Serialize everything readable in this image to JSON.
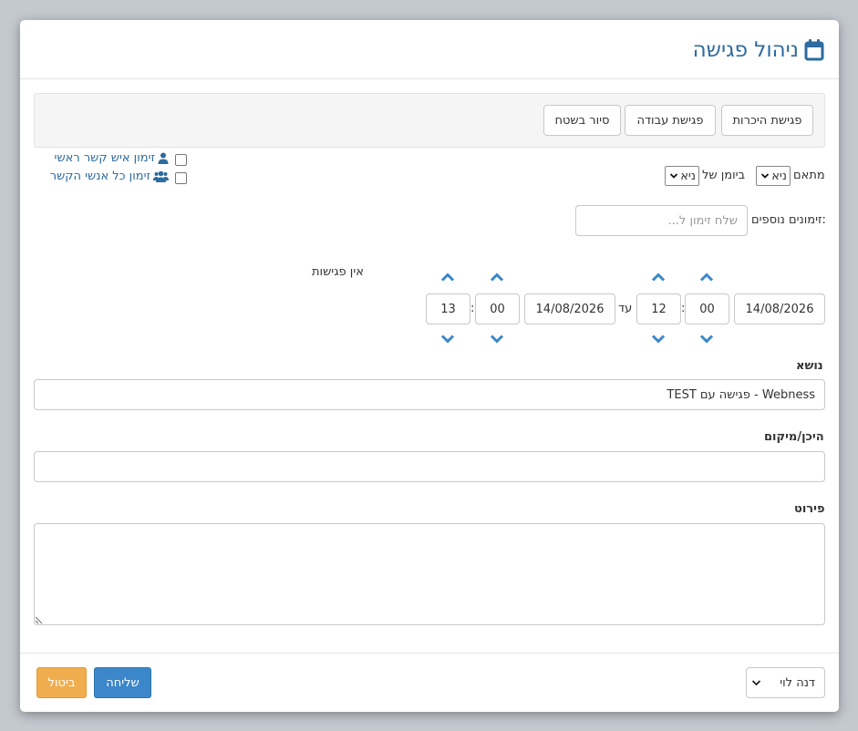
{
  "header": {
    "title": "ניהול פגישה",
    "icon": "calendar-icon"
  },
  "meeting_types": [
    "פגישת היכרות",
    "פגישת עבודה",
    "סיור בשטח"
  ],
  "organizer": {
    "label": "מתאם",
    "value": "ניא"
  },
  "calendar_of": {
    "label": "ביומן של",
    "value": "ניא"
  },
  "invite_main": {
    "label": "זימון איש קשר ראשי",
    "icon": "user-icon",
    "checked": false
  },
  "invite_all": {
    "label": "זימון כל אנשי הקשר",
    "icon": "users-icon",
    "checked": false
  },
  "extra_invites": {
    "label": "זימונים נוספים:",
    "placeholder": "שלח זימון ל..."
  },
  "time": {
    "from_date": "14/08/2026",
    "from_minutes": "00",
    "from_hours": "12",
    "until_label": "עד",
    "to_date": "14/08/2026",
    "to_minutes": "00",
    "to_hours": "13",
    "colon": ":"
  },
  "no_meetings": "אין פגישות",
  "subject": {
    "label": "נושא",
    "value": "Webness - פגישה עם TEST"
  },
  "location": {
    "label": "היכן/מיקום",
    "value": ""
  },
  "details": {
    "label": "פירוט",
    "value": ""
  },
  "footer": {
    "owner": "דנה לוי",
    "send_label": "שליחה",
    "cancel_label": "ביטול"
  },
  "colors": {
    "accent": "#2e6b9e",
    "primary_button": "#3b87c9",
    "warning_button": "#f0ad4e"
  }
}
